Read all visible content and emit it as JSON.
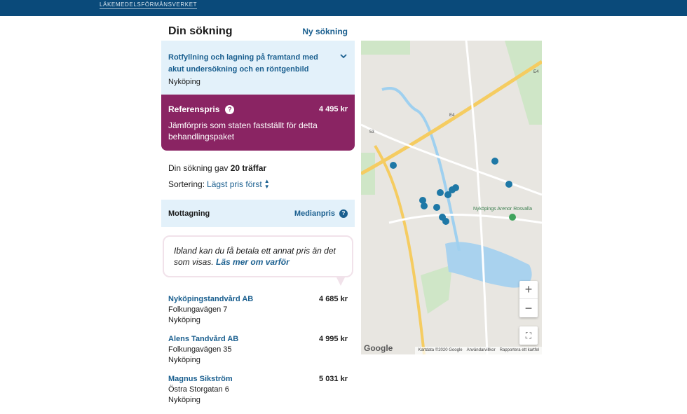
{
  "brand": "LÄKEMEDELSFÖRMÅNSVERKET",
  "header": {
    "title": "Din sökning",
    "new_search": "Ny sökning"
  },
  "search": {
    "treatment": "Rotfyllning och lagning på framtand med akut undersökning och en röntgenbild",
    "location": "Nyköping"
  },
  "reference": {
    "label": "Referenspris",
    "price": "4 495 kr",
    "description": "Jämförpris som staten fastställt för detta behandlingspaket"
  },
  "results": {
    "prefix": "Din sökning gav",
    "count": "20 träffar",
    "sort_label": "Sortering:",
    "sort_value": "Lägst pris först"
  },
  "columns": {
    "clinic": "Mottagning",
    "median": "Medianpris"
  },
  "notice": {
    "text": "Ibland kan du få betala ett annat pris än det som visas.",
    "link": "Läs mer om varför"
  },
  "clinics": [
    {
      "name": "Nyköpingstandvård AB",
      "price": "4 685 kr",
      "street": "Folkungavägen 7",
      "city": "Nyköping"
    },
    {
      "name": "Alens Tandvård AB",
      "price": "4 995 kr",
      "street": "Folkungavägen 35",
      "city": "Nyköping"
    },
    {
      "name": "Magnus Sikström",
      "price": "5 031 kr",
      "street": "Östra Storgatan 6",
      "city": "Nyköping"
    }
  ],
  "map": {
    "google": "Google",
    "footer": [
      "Kartdata ©2020 Google",
      "Användarvillkor",
      "Rapportera ett kartfel"
    ],
    "place_labels": {
      "arena": "Nyköpings Arenor Rosvalla",
      "road_e4": "E4",
      "road_53": "53",
      "road_e4_b": "E4"
    },
    "zoom_in": "+",
    "zoom_out": "−",
    "fullscreen": "⛶"
  }
}
